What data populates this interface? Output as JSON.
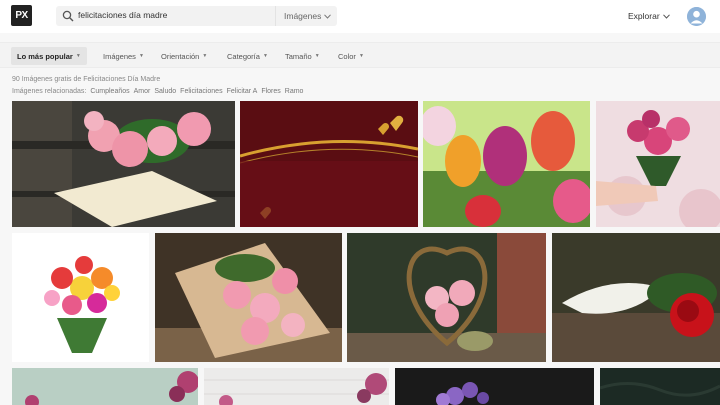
{
  "header": {
    "logo_text": "PX",
    "search": {
      "value": "felicitaciones día madre",
      "type_label": "Imágenes"
    },
    "explore_label": "Explorar"
  },
  "filters": [
    {
      "label": "Lo más popular",
      "active": true
    },
    {
      "label": "Imágenes",
      "active": false
    },
    {
      "label": "Orientación",
      "active": false
    },
    {
      "label": "Categoría",
      "active": false
    },
    {
      "label": "Tamaño",
      "active": false
    },
    {
      "label": "Color",
      "active": false
    }
  ],
  "results": {
    "count_text": "90 Imágenes gratis de Felicitaciones Día Madre",
    "related_label": "Imágenes relacionadas:",
    "related_tags": [
      "Cumpleaños",
      "Amor",
      "Saludo",
      "Felicitaciones",
      "Felicitar A",
      "Flores",
      "Ramo"
    ]
  },
  "images": [
    {
      "subject": "pink roses with envelope on wooden bench",
      "colors": [
        "#3a3a36",
        "#f2a3b3",
        "#f3ead0"
      ]
    },
    {
      "subject": "dark red card with golden hearts",
      "colors": [
        "#5a0d12",
        "#d8a030"
      ]
    },
    {
      "subject": "colorful tulips",
      "colors": [
        "#c9e58a",
        "#b0307a",
        "#e65a3c"
      ]
    },
    {
      "subject": "hand holding pink rose bouquet",
      "colors": [
        "#f0d8dc",
        "#d8457a"
      ]
    },
    {
      "subject": "mixed flower bouquet on white",
      "colors": [
        "#ffffff",
        "#e53b3b",
        "#f7d23a"
      ]
    },
    {
      "subject": "pink carnations wrapped in paper",
      "colors": [
        "#4a3a2a",
        "#f19ab0",
        "#d7b892"
      ]
    },
    {
      "subject": "heart shaped basket with pink roses",
      "colors": [
        "#2f3a2a",
        "#f3b6c4",
        "#8a6a3a"
      ]
    },
    {
      "subject": "red rose with white heart",
      "colors": [
        "#3a3a2a",
        "#c8121a",
        "#f1f1ea"
      ]
    },
    {
      "subject": "mint background with roses",
      "colors": [
        "#b9cfc4",
        "#b04070"
      ]
    },
    {
      "subject": "white wood background with roses",
      "colors": [
        "#ecebea",
        "#b04a78"
      ]
    },
    {
      "subject": "purple flowers on dark background",
      "colors": [
        "#1a1a1a",
        "#8a66c4"
      ]
    },
    {
      "subject": "dark green background",
      "colors": [
        "#1c2a24"
      ]
    }
  ]
}
